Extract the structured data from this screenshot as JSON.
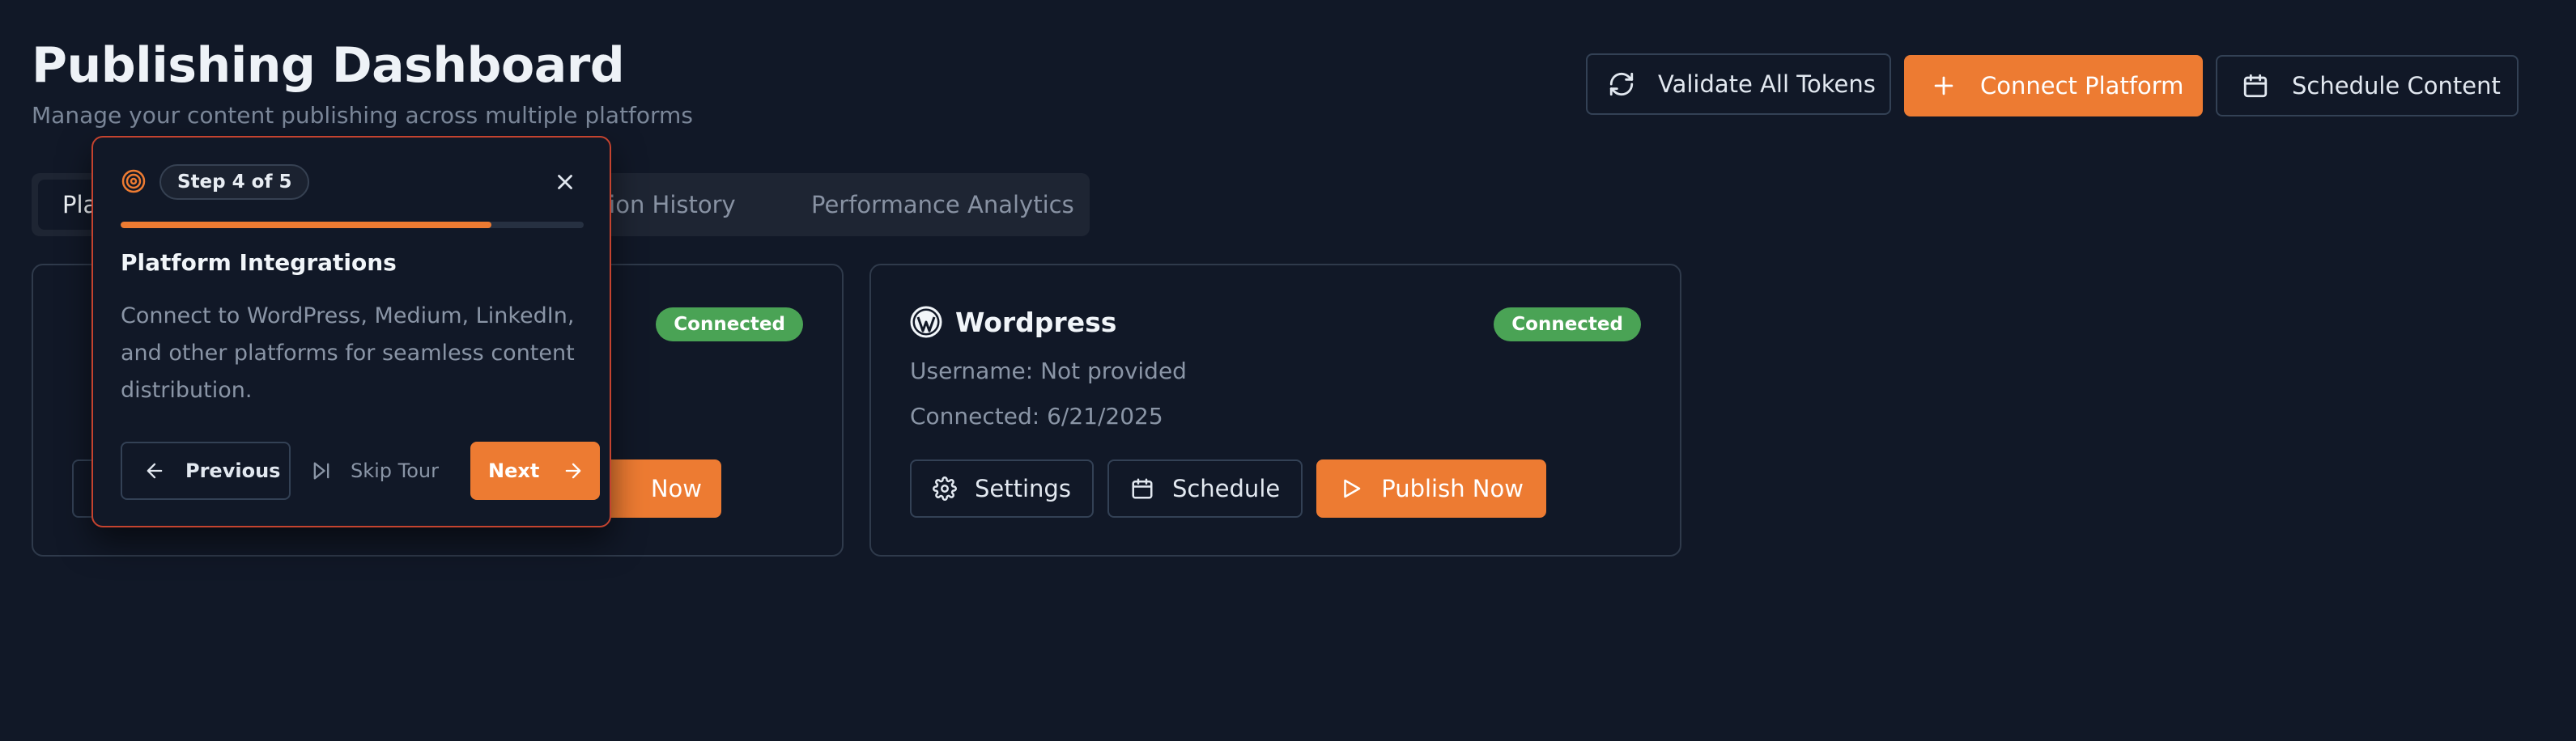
{
  "header": {
    "title": "Publishing Dashboard",
    "subtitle": "Manage your content publishing across multiple platforms",
    "buttons": {
      "validate_label": "Validate All Tokens",
      "connect_label": "Connect Platform",
      "schedule_label": "Schedule Content"
    }
  },
  "tabs": [
    {
      "label": "Pla",
      "active": true
    },
    {
      "label": "ication History",
      "active": false
    },
    {
      "label": "Performance Analytics",
      "active": false
    }
  ],
  "cards": [
    {
      "status": "Connected",
      "publish_label": "Now"
    },
    {
      "title": "Wordpress",
      "status": "Connected",
      "username": "Username: Not provided",
      "connected": "Connected: 6/21/2025",
      "settings_label": "Settings",
      "schedule_label": "Schedule",
      "publish_label": "Publish Now"
    }
  ],
  "tour": {
    "step_label": "Step 4 of 5",
    "progress": 0.8,
    "heading": "Platform Integrations",
    "body": "Connect to WordPress, Medium, LinkedIn, and other platforms for seamless content distribution.",
    "previous_label": "Previous",
    "skip_label": "Skip Tour",
    "next_label": "Next"
  },
  "colors": {
    "background": "#111827",
    "accent": "#ed7b32",
    "success": "#4aa355",
    "tour_border": "#c4432f"
  },
  "icons": {
    "validate": "refresh-icon",
    "connect": "plus-icon",
    "schedule": "calendar-icon",
    "settings": "gear-icon",
    "publish": "play-icon",
    "close": "close-icon",
    "target": "target-icon",
    "previous": "arrow-left-icon",
    "skip": "skip-forward-icon",
    "next": "arrow-right-icon",
    "wordpress": "wordpress-logo-icon",
    "pinterest": "pinterest-logo-icon"
  }
}
